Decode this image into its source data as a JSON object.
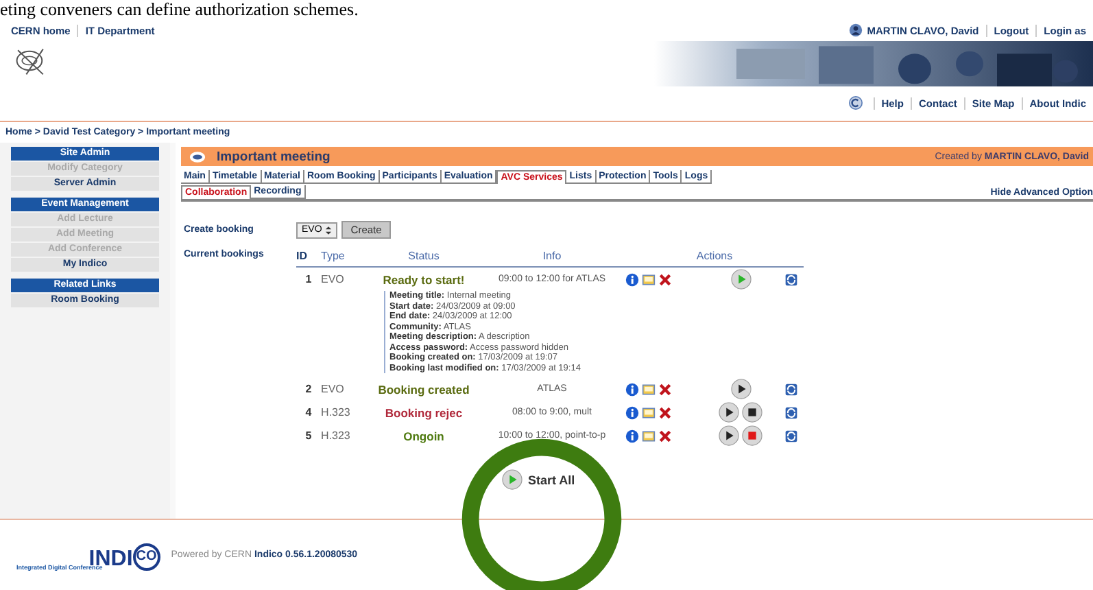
{
  "document_line": "eting conveners can define authorization schemes.",
  "top_links": [
    "CERN home",
    "IT Department"
  ],
  "user": {
    "name": "MARTIN CLAVO, David",
    "links": [
      "Logout",
      "Login as"
    ]
  },
  "nav_links": [
    "Help",
    "Contact",
    "Site Map",
    "About Indic"
  ],
  "breadcrumb": "Home > David Test Category > Important meeting",
  "sidebar": [
    {
      "title": "Site Admin",
      "items": [
        {
          "label": "Modify Category",
          "disabled": true
        },
        {
          "label": "Server Admin",
          "disabled": false
        }
      ]
    },
    {
      "title": "Event Management",
      "items": [
        {
          "label": "Add Lecture",
          "disabled": true
        },
        {
          "label": "Add Meeting",
          "disabled": true
        },
        {
          "label": "Add Conference",
          "disabled": true
        },
        {
          "label": "My Indico",
          "disabled": false
        }
      ]
    },
    {
      "title": "Related Links",
      "items": [
        {
          "label": "Room Booking",
          "disabled": false
        }
      ]
    }
  ],
  "event": {
    "title": "Important meeting",
    "creator": "Created by **MARTIN CLAVO, David**"
  },
  "tabs": [
    {
      "label": "Main",
      "selected": false
    },
    {
      "label": "Timetable",
      "selected": false
    },
    {
      "label": "Material",
      "selected": false
    },
    {
      "label": "Room Booking",
      "selected": false
    },
    {
      "label": "Participants",
      "selected": false
    },
    {
      "label": "Evaluation",
      "selected": false
    },
    {
      "label": "AVC Services",
      "selected": true
    },
    {
      "label": "Lists",
      "selected": false
    },
    {
      "label": "Protection",
      "selected": false
    },
    {
      "label": "Tools",
      "selected": false
    },
    {
      "label": "Logs",
      "selected": false
    }
  ],
  "subtabs": [
    {
      "label": "Collaboration",
      "selected": true
    },
    {
      "label": "Recording",
      "selected": false
    }
  ],
  "advanced_link": "Hide Advanced Option",
  "create_booking": {
    "label": "Create booking",
    "select_value": "EVO",
    "button": "Create"
  },
  "bookings": {
    "label": "Current bookings",
    "columns": [
      "ID",
      "Type",
      "Status",
      "Info",
      "Actions"
    ],
    "rows": [
      {
        "id": "1",
        "type": "EVO",
        "status": "Ready to start!",
        "color": "#5a6b10",
        "info": "09:00 to 12:00 for ATLAS",
        "play_enabled": true,
        "details": [
          {
            "key": "Meeting title:",
            "value": "Internal meeting"
          },
          {
            "key": "Start date:",
            "value": "24/03/2009 at 09:00"
          },
          {
            "key": "End date:",
            "value": "24/03/2009 at 12:00"
          },
          {
            "key": "Community:",
            "value": "ATLAS"
          },
          {
            "key": "Meeting description:",
            "value": "A description"
          },
          {
            "key": "Access password:",
            "value": "Access password hidden"
          },
          {
            "key": "Booking created on:",
            "value": "17/03/2009 at 19:07"
          },
          {
            "key": "Booking last modified on:",
            "value": "17/03/2009 at 19:14"
          }
        ]
      },
      {
        "id": "2",
        "type": "EVO",
        "status": "Booking created",
        "color": "#5a6b10",
        "info": "ATLAS",
        "play_enabled": false
      },
      {
        "id": "4",
        "type": "H.323",
        "status": "Booking rejec",
        "color": "#b0283a",
        "info": "08:00 to 9:00, mult",
        "play_enabled": false,
        "stop_active": false
      },
      {
        "id": "5",
        "type": "H.323",
        "status": "Ongoin",
        "color": "#4f7a10",
        "info": "10:00 to 12:00, point-to-p",
        "play_enabled": false,
        "stop_active": true
      }
    ],
    "start_all": "Start All"
  },
  "footer": {
    "logo_main": "INDI",
    "logo_ring": "CO",
    "logo_sub": "Integrated Digital Conference",
    "powered": "Powered by CERN **Indico 0.56.1.20080530**"
  }
}
